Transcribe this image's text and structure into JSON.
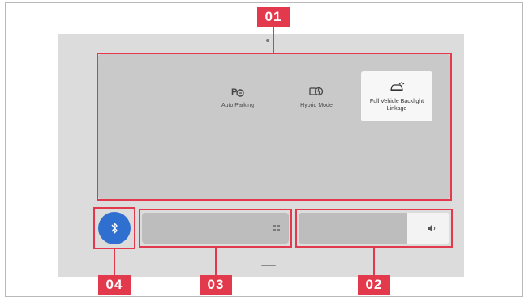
{
  "panel": {
    "tiles": [
      {
        "label": "",
        "icon": "blank",
        "state": "faded"
      },
      {
        "label": "Auto Parking",
        "icon": "auto-parking-icon",
        "state": "normal"
      },
      {
        "label": "Hybrid Mode",
        "icon": "hybrid-mode-icon",
        "state": "normal"
      },
      {
        "label": "Full Vehicle Backlight Linkage",
        "icon": "vehicle-backlight-icon",
        "state": "selected"
      }
    ]
  },
  "bottom": {
    "bluetooth_icon": "bluetooth-icon",
    "left_bar_icon": "grid-icon",
    "right_bar_icon": "volume-icon"
  },
  "callouts": {
    "c01": "01",
    "c02": "02",
    "c03": "03",
    "c04": "04"
  },
  "colors": {
    "callout": "#e23a4c",
    "bluetooth": "#2f6fd0",
    "panel": "#c9c9c9"
  }
}
